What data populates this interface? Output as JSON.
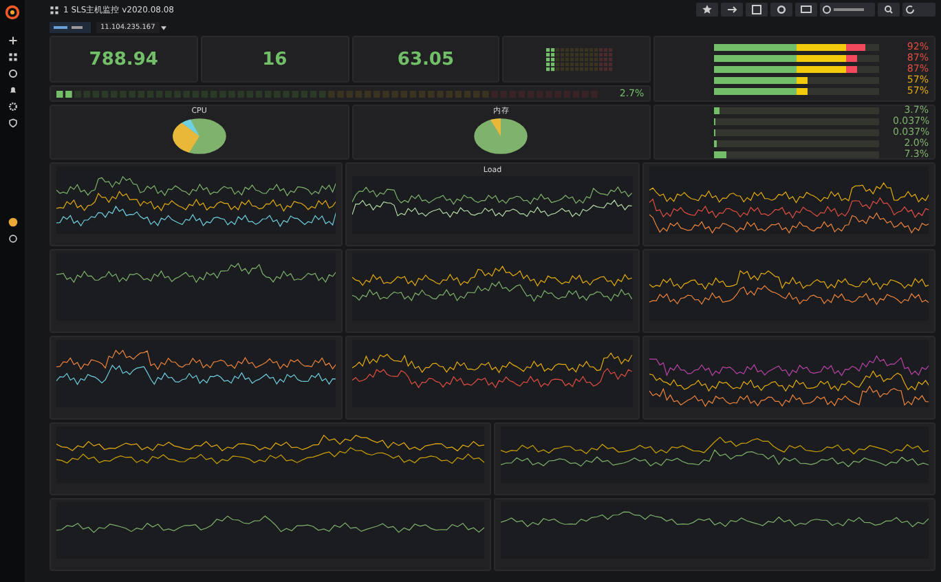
{
  "header": {
    "title": "1 SLS主机监控 v2020.08.08",
    "host": "11.104.235.167"
  },
  "stats": [
    {
      "value": "788.94"
    },
    {
      "value": "16"
    },
    {
      "value": "63.05"
    }
  ],
  "cpu_gauge": {
    "level": 0.027,
    "reading": "2.7%"
  },
  "gauges_top": [
    {
      "level": 0.92,
      "reading": "92%",
      "color": "#e24d42"
    },
    {
      "level": 0.87,
      "reading": "87%",
      "color": "#e24d42"
    },
    {
      "level": 0.87,
      "reading": "87%",
      "color": "#e24d42"
    },
    {
      "level": 0.57,
      "reading": "57%",
      "color": "#e5ac0e"
    },
    {
      "level": 0.57,
      "reading": "57%",
      "color": "#e5ac0e"
    }
  ],
  "gauges_bottom": [
    {
      "level": 0.037,
      "reading": "3.7%",
      "color": "#7eb26d"
    },
    {
      "level": 0.00037,
      "reading": "0.037%",
      "color": "#7eb26d"
    },
    {
      "level": 0.00037,
      "reading": "0.037%",
      "color": "#7eb26d"
    },
    {
      "level": 0.02,
      "reading": "2.0%",
      "color": "#7eb26d"
    },
    {
      "level": 0.073,
      "reading": "7.3%",
      "color": "#7eb26d"
    }
  ],
  "pies": [
    {
      "title": "CPU"
    },
    {
      "title": "内存"
    }
  ],
  "graphs": [
    {
      "series": [
        {
          "color": "#7eb26d"
        },
        {
          "color": "#e5ac0e"
        },
        {
          "color": "#6ed0e0"
        }
      ]
    },
    {
      "title": "Load",
      "series": [
        {
          "color": "#7eb26d"
        },
        {
          "color": "#b7dbab"
        }
      ]
    },
    {
      "series": [
        {
          "color": "#e5ac0e"
        },
        {
          "color": "#e24d42"
        },
        {
          "color": "#ef843c"
        }
      ]
    },
    {
      "series": [
        {
          "color": "#7eb26d"
        }
      ]
    },
    {
      "series": [
        {
          "color": "#e5ac0e"
        },
        {
          "color": "#7eb26d"
        }
      ]
    },
    {
      "series": [
        {
          "color": "#e5ac0e"
        },
        {
          "color": "#ef843c"
        }
      ]
    },
    {
      "series": [
        {
          "color": "#ef843c"
        },
        {
          "color": "#6ed0e0"
        }
      ]
    },
    {
      "series": [
        {
          "color": "#e5ac0e"
        },
        {
          "color": "#e24d42"
        }
      ]
    },
    {
      "series": [
        {
          "color": "#ba43a9"
        },
        {
          "color": "#e5ac0e"
        },
        {
          "color": "#ef843c"
        }
      ]
    },
    {
      "series": [
        {
          "color": "#e5ac0e"
        },
        {
          "color": "#cca300"
        }
      ]
    },
    {
      "series": [
        {
          "color": "#cca300"
        },
        {
          "color": "#7eb26d"
        }
      ]
    },
    {
      "series": [
        {
          "color": "#7eb26d"
        }
      ]
    },
    {
      "series": [
        {
          "color": "#7eb26d"
        }
      ]
    }
  ]
}
